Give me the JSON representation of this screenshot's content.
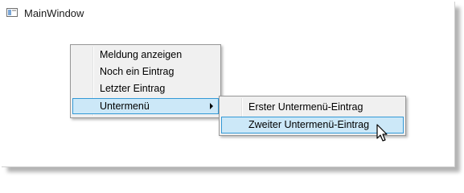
{
  "window": {
    "title": "MainWindow",
    "icon": "window-app-icon"
  },
  "context_menu": {
    "items": [
      {
        "label": "Meldung anzeigen"
      },
      {
        "label": "Noch ein Eintrag"
      },
      {
        "label": "Letzter Eintrag"
      },
      {
        "label": "Untermenü",
        "has_submenu": true,
        "state": "highlighted"
      }
    ]
  },
  "submenu": {
    "items": [
      {
        "label": "Erster Untermenü-Eintrag"
      },
      {
        "label": "Zweiter Untermenü-Eintrag",
        "state": "hovered"
      }
    ]
  },
  "colors": {
    "menu_background": "#f0f0f0",
    "highlight_fill": "#cce8f8",
    "highlight_border": "#3399d7"
  }
}
